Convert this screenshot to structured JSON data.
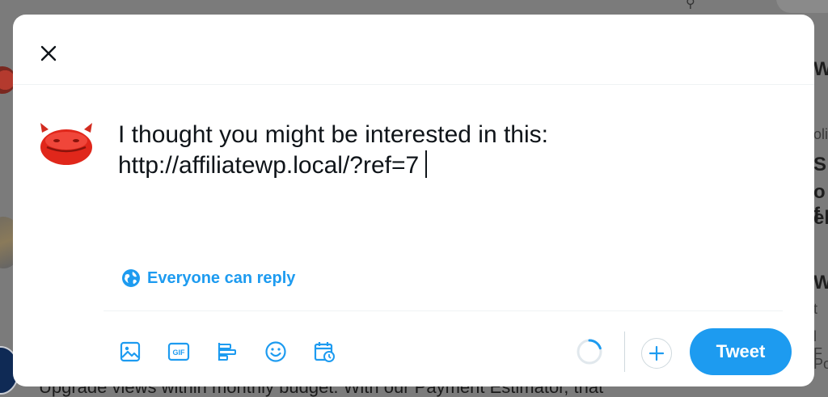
{
  "compose": {
    "line1": "I thought you might be interested in this:",
    "line2": "http://affiliatewp.local/?ref=7"
  },
  "reply_setting": {
    "label": "Everyone can reply",
    "icon": "globe-icon"
  },
  "toolbar": {
    "icons": [
      "media-icon",
      "gif-icon",
      "poll-icon",
      "emoji-icon",
      "schedule-icon"
    ]
  },
  "actions": {
    "tweet_label": "Tweet",
    "add_icon": "plus-icon"
  },
  "character_progress": 0.2,
  "background": {
    "bottom_text": "Upgrade views within monthly budget. With our Payment Estimator, that",
    "right_fragments": [
      "W",
      "oli",
      "S",
      "o f",
      "el",
      "W",
      "t",
      "l F",
      "Poli"
    ]
  },
  "colors": {
    "accent": "#1d9bf0",
    "text": "#0f1419",
    "divider": "#eff3f4"
  }
}
